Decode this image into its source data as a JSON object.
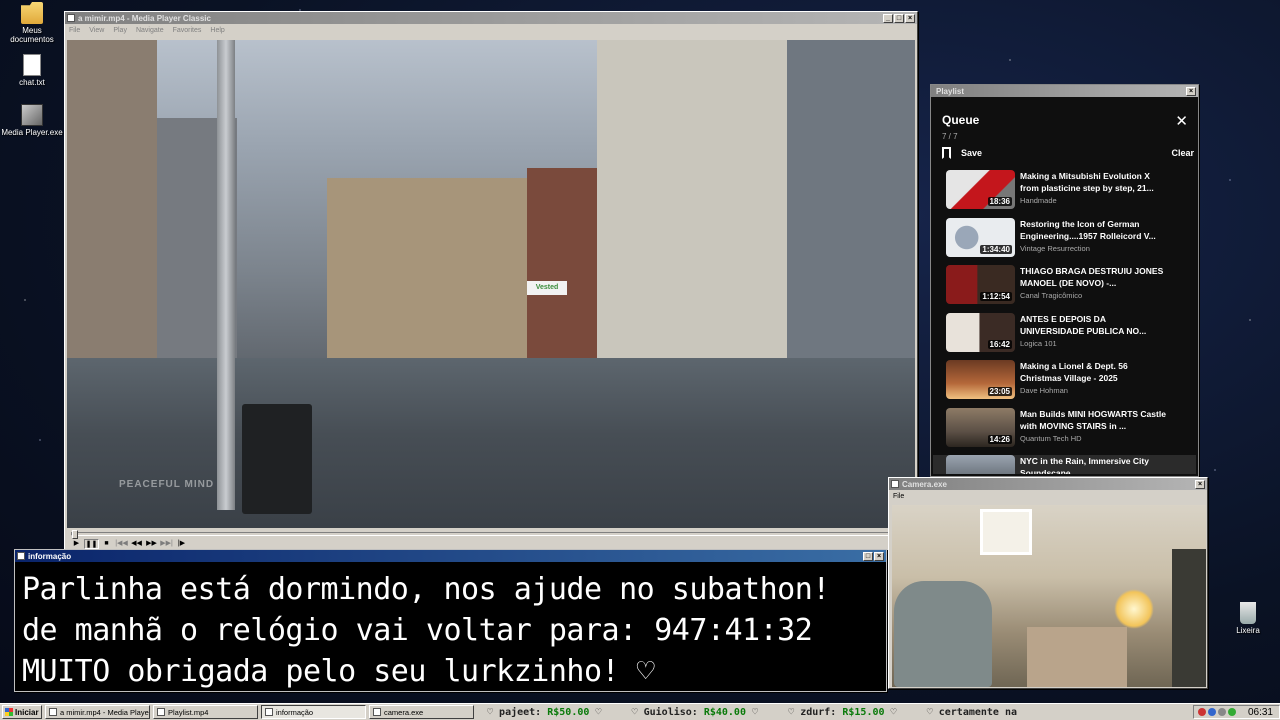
{
  "desktop": {
    "icons": [
      {
        "label": "Meus documentos",
        "icon": "folder-icon"
      },
      {
        "label": "chat.txt",
        "icon": "text-file-icon"
      },
      {
        "label": "Media Player.exe",
        "icon": "exe-icon"
      },
      {
        "label": "Lixeira",
        "icon": "recycle-bin-icon"
      }
    ]
  },
  "mpc": {
    "title": "a mimir.mp4 - Media Player Classic",
    "menu": [
      "File",
      "View",
      "Play",
      "Navigate",
      "Favorites",
      "Help"
    ],
    "watermark": "PEACEFUL MIND",
    "store_sign": "Vested",
    "progress": 0.0,
    "buttons": [
      "play",
      "pause",
      "stop",
      "prev",
      "rewind",
      "forward",
      "next",
      "frame-step"
    ]
  },
  "playlist": {
    "window_title": "Playlist",
    "queue_title": "Queue",
    "count": "7 / 7",
    "save_label": "Save",
    "clear_label": "Clear",
    "items": [
      {
        "title": "Making a Mitsubishi Evolution X from plasticine step by step, 21...",
        "channel": "Handmade",
        "duration": "18:36",
        "thumb": "#d9d9d9",
        "accent": "#c4161c"
      },
      {
        "title": "Restoring the Icon of German Engineering....1957 Rolleicord V...",
        "channel": "Vintage Resurrection",
        "duration": "1:34:40",
        "thumb": "#e9ecef",
        "accent": "#7a8aa0"
      },
      {
        "title": "THIAGO BRAGA DESTRUIU JONES MANOEL (DE NOVO) -...",
        "channel": "Canal Tragicômico",
        "duration": "1:12:54",
        "thumb": "#8a1b1b",
        "accent": "#f2d23a"
      },
      {
        "title": "ANTES E DEPOIS DA UNIVERSIDADE PUBLICA NO...",
        "channel": "Logica 101",
        "duration": "16:42",
        "thumb": "#e8e2da",
        "accent": "#b3261e"
      },
      {
        "title": "Making a Lionel & Dept. 56 Christmas Village - 2025",
        "channel": "Dave Hohman",
        "duration": "23:05",
        "thumb": "#6b3a22",
        "accent": "#f0a050"
      },
      {
        "title": "Man Builds MINI HOGWARTS Castle with MOVING STAIRS in ...",
        "channel": "Quantum Tech HD",
        "duration": "14:26",
        "thumb": "#5c5046",
        "accent": "#c9a46a"
      },
      {
        "title": "NYC in the Rain, Immersive City Soundscape",
        "channel": "",
        "duration": "",
        "thumb": "#6f7780",
        "accent": "#3a4047"
      }
    ]
  },
  "camera": {
    "title": "Camera.exe",
    "menu": [
      "File"
    ]
  },
  "info": {
    "title": "informação",
    "lines": [
      "Parlinha está dormindo, nos ajude no subathon!",
      "de manhã o relógio vai voltar para:  947:41:32",
      "MUITO obrigada pelo seu lurkzinho! ♡"
    ]
  },
  "taskbar": {
    "start_label": "Iniciar",
    "tasks": [
      {
        "label": "a mimir.mp4 - Media Playe...",
        "pressed": false
      },
      {
        "label": "Playlist.mp4",
        "pressed": false
      },
      {
        "label": "informação",
        "pressed": true
      },
      {
        "label": "camera.exe",
        "pressed": false
      }
    ],
    "ticker": [
      {
        "name": "pajeet:",
        "amount": "R$50.00"
      },
      {
        "name": "Guioliso:",
        "amount": "R$40.00"
      },
      {
        "name": "zdurf:",
        "amount": "R$15.00"
      },
      {
        "name": "certamente na",
        "amount": ""
      }
    ],
    "clock": "06:31"
  }
}
